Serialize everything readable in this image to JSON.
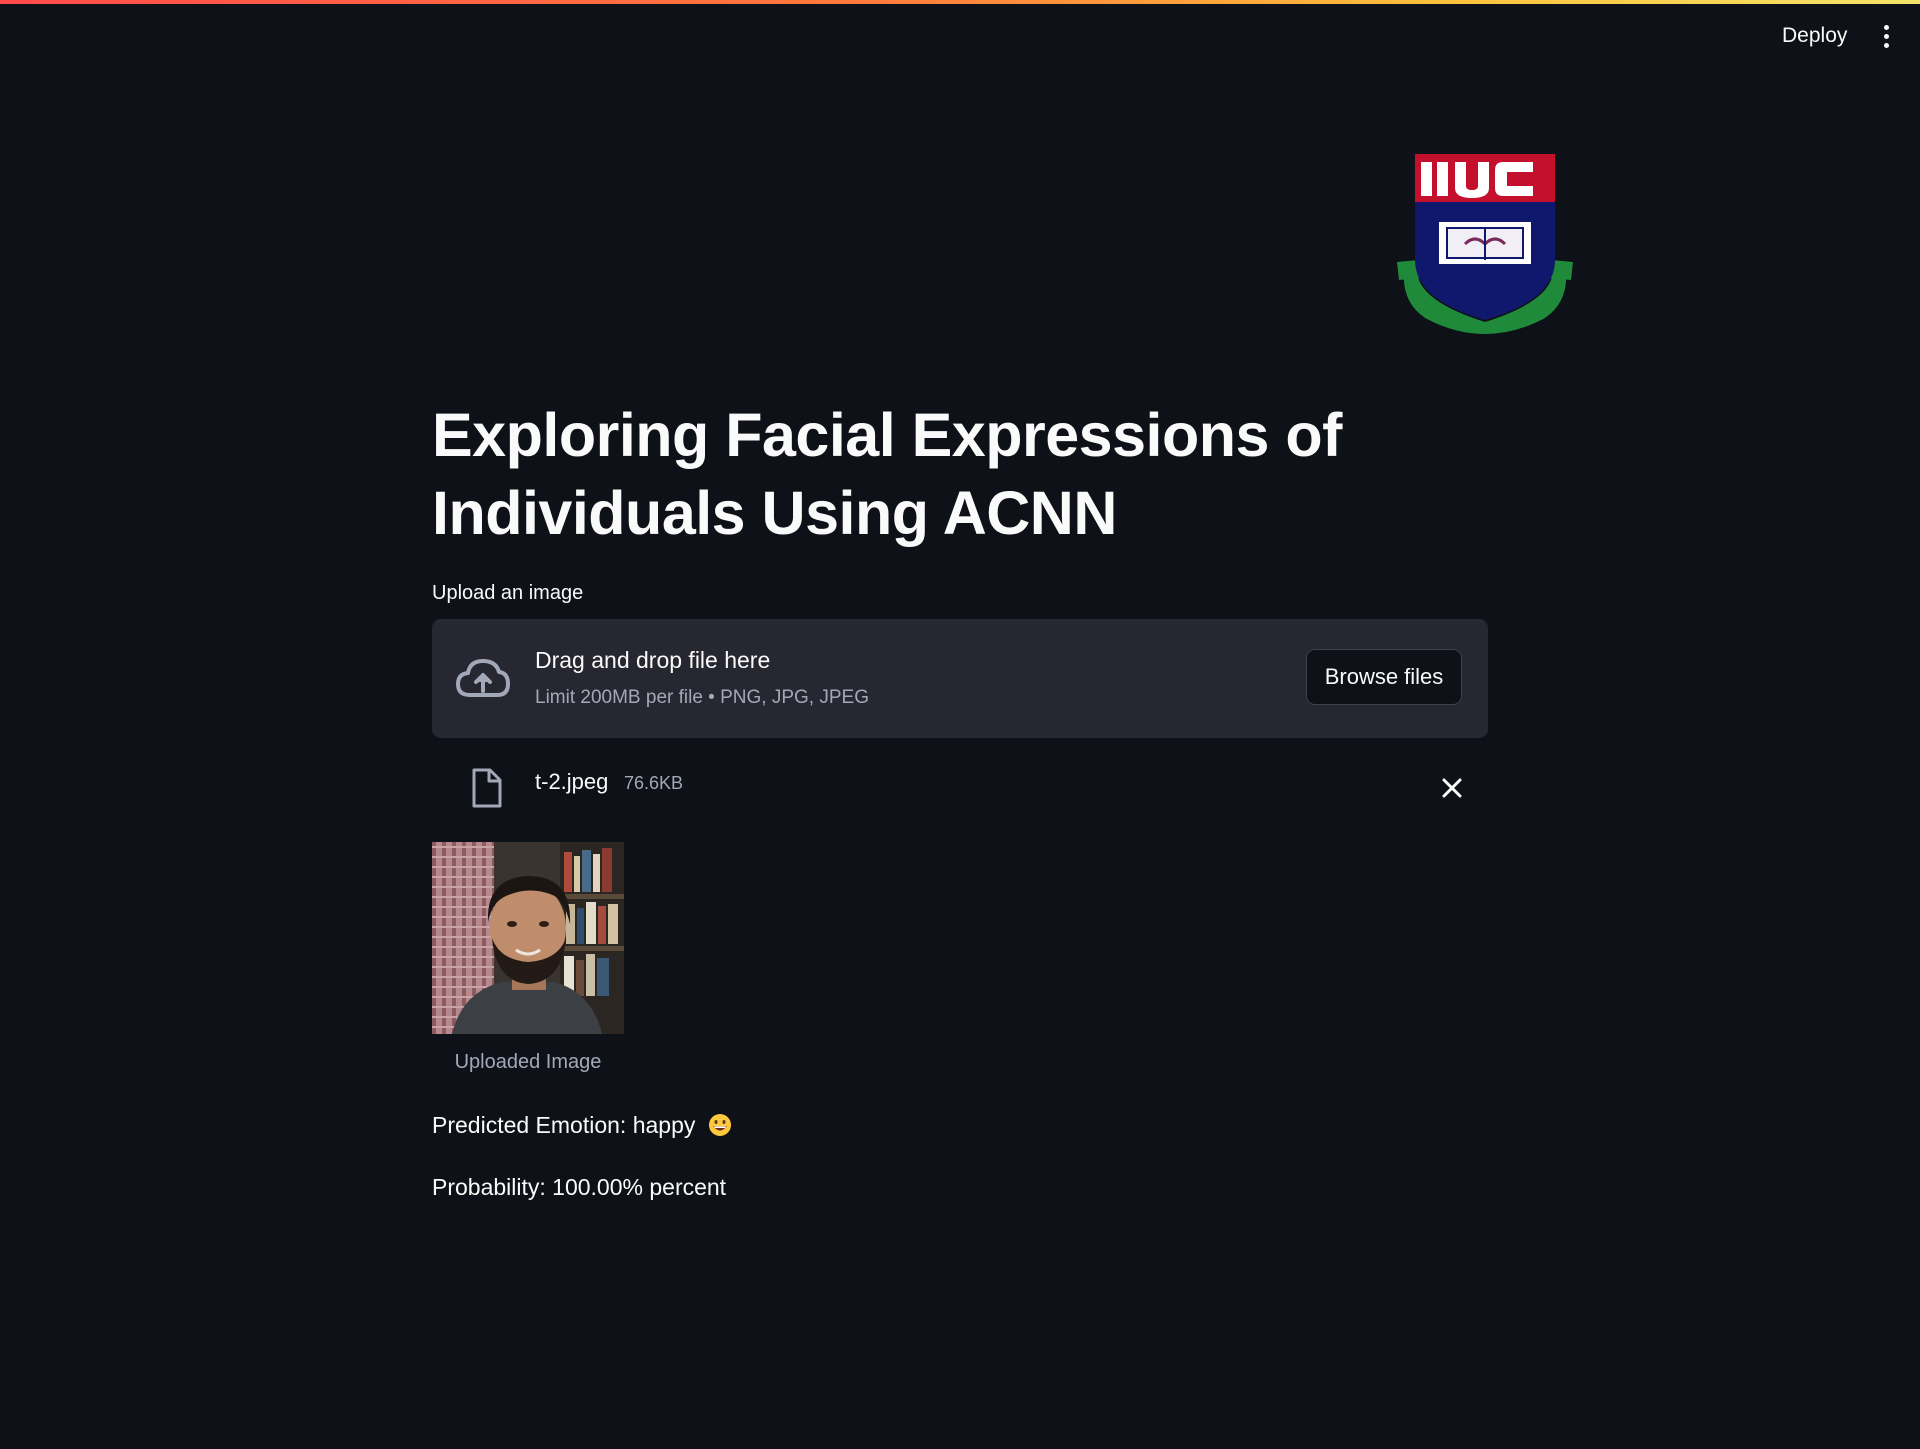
{
  "header": {
    "deploy_label": "Deploy",
    "menu_icon": "kebab-menu-icon",
    "accent_gradient": [
      "#ff4b4b",
      "#ff7a3c",
      "#fdc13c",
      "#f4e46a"
    ]
  },
  "logo": {
    "text": "IIUC",
    "icon": "university-crest-logo"
  },
  "page": {
    "title": "Exploring Facial Expressions of Individuals Using ACNN"
  },
  "uploader": {
    "label": "Upload an image",
    "drop_title": "Drag and drop file here",
    "limit_text": "Limit 200MB per file • PNG, JPG, JPEG",
    "browse_label": "Browse files",
    "upload_icon": "cloud-upload-icon"
  },
  "file": {
    "name": "t-2.jpeg",
    "size": "76.6KB",
    "file_icon": "file-icon",
    "remove_icon": "close-icon"
  },
  "image": {
    "caption": "Uploaded Image"
  },
  "results": {
    "emotion_text": "Predicted Emotion: happy",
    "emotion_icon": "grinning-face-emoji",
    "probability_text": "Probability: 100.00% percent"
  },
  "colors": {
    "background": "#0e1117",
    "surface": "#262730",
    "text": "#fafafa",
    "muted": "#a3a8b8"
  }
}
